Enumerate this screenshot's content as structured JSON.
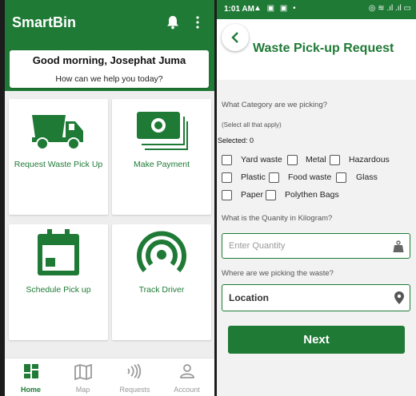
{
  "colors": {
    "brand_green": "#1f7a36",
    "tile_label": "#1f7a36",
    "nav_inactive": "#999999"
  },
  "home": {
    "app_title": "SmartBin",
    "header_icons": [
      "bell-icon",
      "more-vertical-icon"
    ],
    "greeting": "Good morning, Josephat Juma",
    "greeting_sub": "How can we help you today?",
    "tiles": [
      {
        "label": "Request Waste Pick Up",
        "icon": "truck-icon"
      },
      {
        "label": "Make Payment",
        "icon": "money-icon"
      },
      {
        "label": "Schedule Pick up",
        "icon": "calendar-icon"
      },
      {
        "label": "Track Driver",
        "icon": "signal-icon"
      }
    ],
    "nav": [
      {
        "label": "Home",
        "icon": "dashboard-icon",
        "active": true
      },
      {
        "label": "Map",
        "icon": "map-icon",
        "active": false
      },
      {
        "label": "Requests",
        "icon": "broadcast-icon",
        "active": false
      },
      {
        "label": "Account",
        "icon": "person-icon",
        "active": false
      }
    ]
  },
  "request": {
    "status_time": "1:01 AM",
    "title": "Waste Pick-up Request",
    "category_question": "What Category are we picking?",
    "category_hint": "(Select all that apply)",
    "selected_text": "Selected: 0",
    "categories": [
      "Yard waste",
      "Metal",
      "Hazardous",
      "Plastic",
      "Food waste",
      "Glass",
      "Paper",
      "Polythen Bags"
    ],
    "quantity_question": "What is the Quanity in Kilogram?",
    "quantity_placeholder": "Enter Quantity",
    "location_question": "Where are we picking the waste?",
    "location_placeholder": "Location",
    "next_label": "Next"
  }
}
